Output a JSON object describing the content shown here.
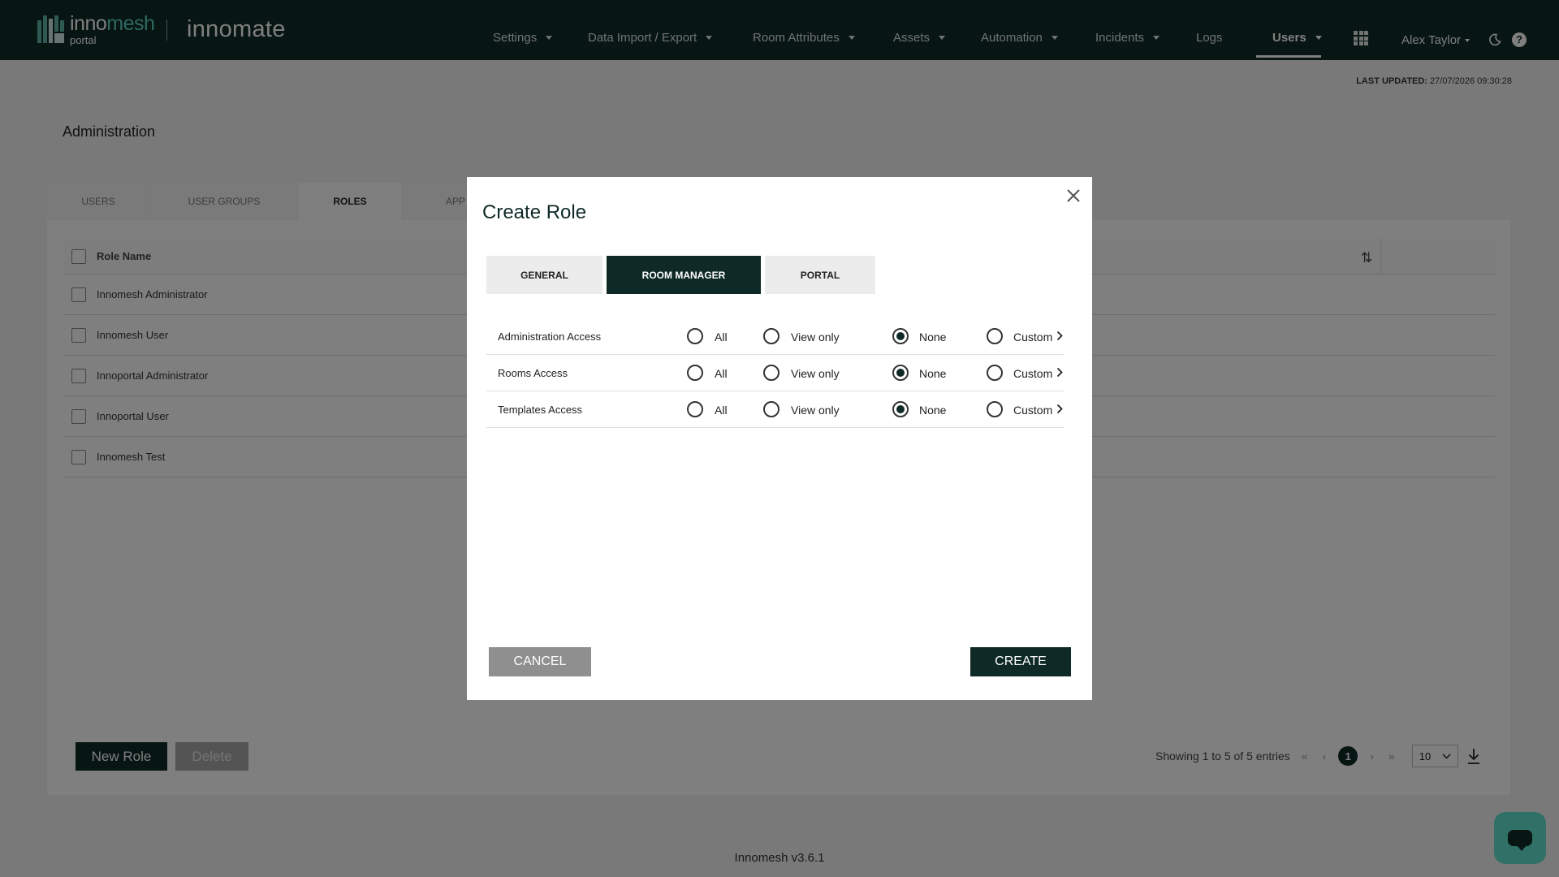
{
  "brand": {
    "logo_prefix": "inno",
    "logo_suffix": "mesh",
    "logo_sub": "portal",
    "app_name": "innomate"
  },
  "nav": {
    "items": [
      {
        "label": "Settings"
      },
      {
        "label": "Data Import / Export"
      },
      {
        "label": "Room Attributes"
      },
      {
        "label": "Assets"
      },
      {
        "label": "Automation"
      },
      {
        "label": "Incidents"
      },
      {
        "label": "Logs"
      },
      {
        "label": "Users"
      }
    ],
    "active": "Users",
    "user_name": "Alex Taylor",
    "help_glyph": "?"
  },
  "status": {
    "last_updated_label": "LAST UPDATED:",
    "last_updated_value": "27/07/2026 09:30:28"
  },
  "page": {
    "title": "Administration"
  },
  "tabs": [
    {
      "label": "USERS"
    },
    {
      "label": "USER GROUPS"
    },
    {
      "label": "ROLES"
    },
    {
      "label": "APP"
    }
  ],
  "table": {
    "header": "Role Name",
    "rows": [
      {
        "name": "Innomesh Administrator"
      },
      {
        "name": "Innomesh User"
      },
      {
        "name": "Innoportal Administrator"
      },
      {
        "name": "Innoportal User"
      },
      {
        "name": "Innomesh Test"
      }
    ]
  },
  "actions": {
    "new_role": "New Role",
    "delete": "Delete"
  },
  "pagination": {
    "summary": "Showing 1 to 5 of 5 entries",
    "current_page": "1",
    "per_page": "10"
  },
  "footer": {
    "version": "Innomesh v3.6.1"
  },
  "modal": {
    "title": "Create Role",
    "tabs": [
      {
        "label": "GENERAL"
      },
      {
        "label": "ROOM MANAGER"
      },
      {
        "label": "PORTAL"
      }
    ],
    "active_tab": "ROOM MANAGER",
    "options": [
      "All",
      "View only",
      "None",
      "Custom"
    ],
    "permissions": [
      {
        "label": "Administration Access",
        "selected": "None"
      },
      {
        "label": "Rooms Access",
        "selected": "None"
      },
      {
        "label": "Templates Access",
        "selected": "None"
      }
    ],
    "cancel_label": "CANCEL",
    "create_label": "CREATE"
  },
  "colors": {
    "primary": "#0f2a26",
    "accent": "#5ee0cf"
  },
  "icons": [
    "apps-grid-icon",
    "moon-icon",
    "help-icon",
    "close-icon",
    "sort-icon",
    "download-icon",
    "chat-icon",
    "chevron-right-icon",
    "chevron-down-icon"
  ]
}
